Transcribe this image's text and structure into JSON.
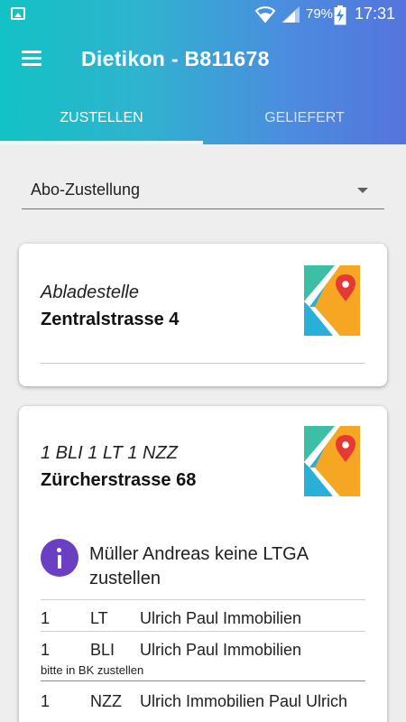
{
  "status_bar": {
    "battery_percent": "79%",
    "time": "17:31"
  },
  "app_bar": {
    "title": "Dietikon - B811678",
    "menu_icon": "hamburger-menu-icon"
  },
  "tabs": [
    {
      "label": "ZUSTELLEN",
      "active": true
    },
    {
      "label": "GELIEFERT",
      "active": false
    }
  ],
  "filter": {
    "selected": "Abo-Zustellung"
  },
  "cards": [
    {
      "label": "Abladestelle",
      "address": "Zentralstrasse 4",
      "icon": "map-pin-icon"
    },
    {
      "label": "1 BLI 1 LT 1 NZZ",
      "address": "Zürcherstrasse 68",
      "icon": "map-pin-icon",
      "info": "Müller Andreas keine LTGA zustellen",
      "items": [
        {
          "qty": "1",
          "code": "LT",
          "name": "Ulrich Paul Immobilien",
          "note": ""
        },
        {
          "qty": "1",
          "code": "BLI",
          "name": "Ulrich Paul Immobilien",
          "note": "bitte in BK zustellen"
        },
        {
          "qty": "1",
          "code": "NZZ",
          "name": "Ulrich Immobilien  Paul Ulrich",
          "note": ""
        }
      ]
    }
  ],
  "colors": {
    "header_gradient_start": "#12c2c4",
    "header_gradient_end": "#5574dd",
    "info_icon": "#6a3fc2",
    "map_teal": "#3dbfa6",
    "map_orange": "#f5a623",
    "map_blue": "#29b0d8",
    "map_pin": "#e53935"
  }
}
